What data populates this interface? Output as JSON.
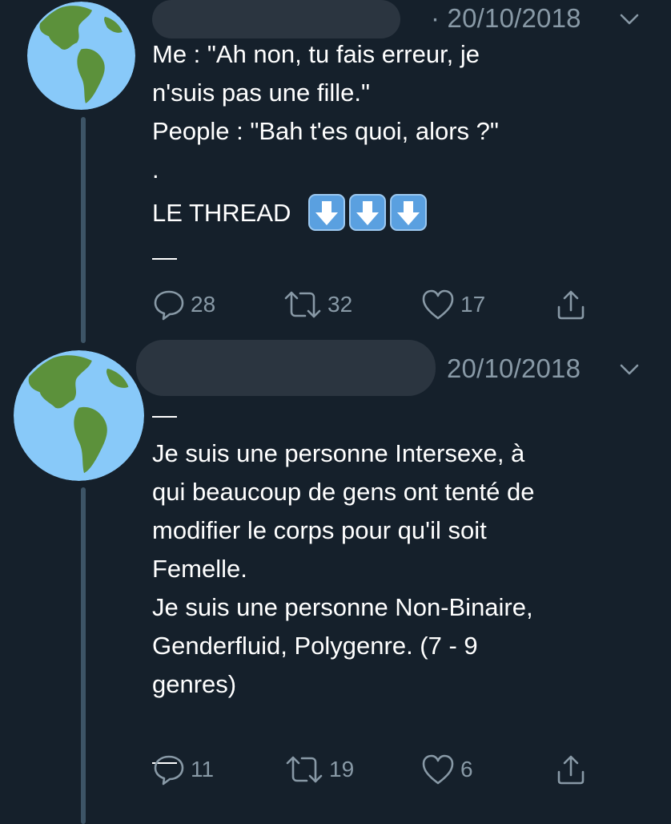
{
  "tweets": [
    {
      "date": "· 20/10/2018",
      "lines": [
        "Me :  \"Ah non, tu fais erreur, je",
        "n'suis pas une fille.\"",
        "People :  \"Bah t'es quoi, alors ?\"",
        ".",
        "LE THREAD",
        "—"
      ],
      "thread_emoji": [
        "down-arrow-emoji",
        "down-arrow-emoji",
        "down-arrow-emoji"
      ],
      "actions": {
        "replies": "28",
        "retweets": "32",
        "likes": "17"
      }
    },
    {
      "date": "20/10/2018",
      "lines": [
        "—",
        "Je suis une personne Intersexe, à",
        "qui beaucoup de gens ont tenté de",
        "modifier le corps pour qu'il soit",
        "Femelle.",
        "Je suis une personne Non-Binaire,",
        "Genderfluid, Polygenre. (7 - 9",
        "genres)",
        "",
        "—"
      ],
      "actions": {
        "replies": "11",
        "retweets": "19",
        "likes": "6"
      }
    }
  ],
  "icons": {
    "avatar": "earth-globe-americas-icon",
    "menu": "chevron-down-icon",
    "reply": "reply-icon",
    "retweet": "retweet-icon",
    "like": "heart-icon",
    "share": "share-icon"
  },
  "colors": {
    "background": "#15202b",
    "text": "#ffffff",
    "secondary": "#8899a6",
    "thread_line": "#3d5466",
    "redacted_name": "#2b3540",
    "emoji_blue": "#5aa0e0"
  }
}
